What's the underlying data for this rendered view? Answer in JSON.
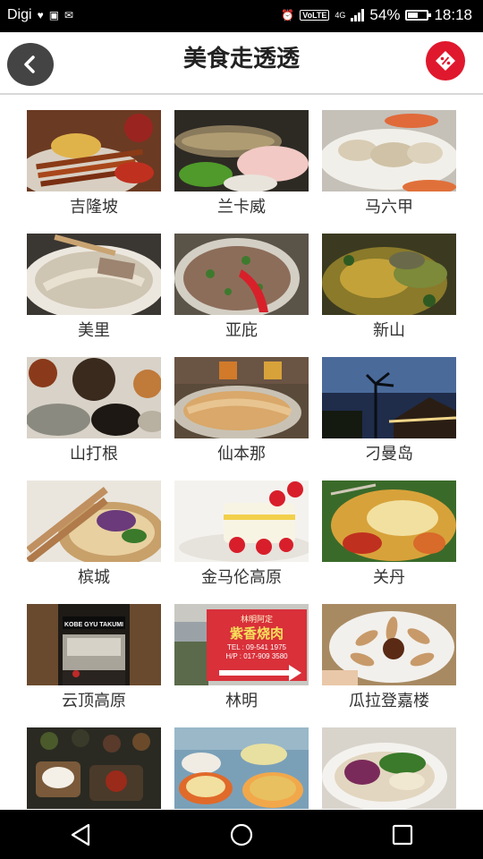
{
  "status_bar": {
    "carrier": "Digi",
    "battery_percent": "54%",
    "battery_level": 0.54,
    "time": "18:18",
    "network": "4G",
    "volte": "VoLTE",
    "icons": [
      "heart-monitor-icon",
      "image-icon",
      "mail-icon",
      "alarm-icon",
      "volte-icon",
      "signal-icon",
      "battery-icon"
    ]
  },
  "header": {
    "title": "美食走透透",
    "back_icon": "chevron-left-icon",
    "promo_icon": "discount-tag-icon",
    "promo_color": "#e0182d"
  },
  "destinations": [
    {
      "name": "吉隆坡"
    },
    {
      "name": "兰卡威"
    },
    {
      "name": "马六甲"
    },
    {
      "name": "美里"
    },
    {
      "name": "亚庇"
    },
    {
      "name": "新山"
    },
    {
      "name": "山打根"
    },
    {
      "name": "仙本那"
    },
    {
      "name": "刁曼岛"
    },
    {
      "name": "槟城"
    },
    {
      "name": "金马伦高原"
    },
    {
      "name": "关丹"
    },
    {
      "name": "云顶高原"
    },
    {
      "name": "林明"
    },
    {
      "name": "瓜拉登嘉楼"
    },
    {
      "name": ""
    },
    {
      "name": ""
    },
    {
      "name": ""
    }
  ],
  "photo_text": {
    "kobe_sign": "KOBE GYU TAKUMI",
    "shop_top": "林明阿定",
    "shop_name": "紫香烧肉",
    "shop_tel": "TEL : 09-541 1975",
    "shop_hp": "H/P : 017-909 3580"
  },
  "nav_bar": {
    "icons": [
      "back-triangle-icon",
      "home-circle-icon",
      "recents-square-icon"
    ]
  }
}
